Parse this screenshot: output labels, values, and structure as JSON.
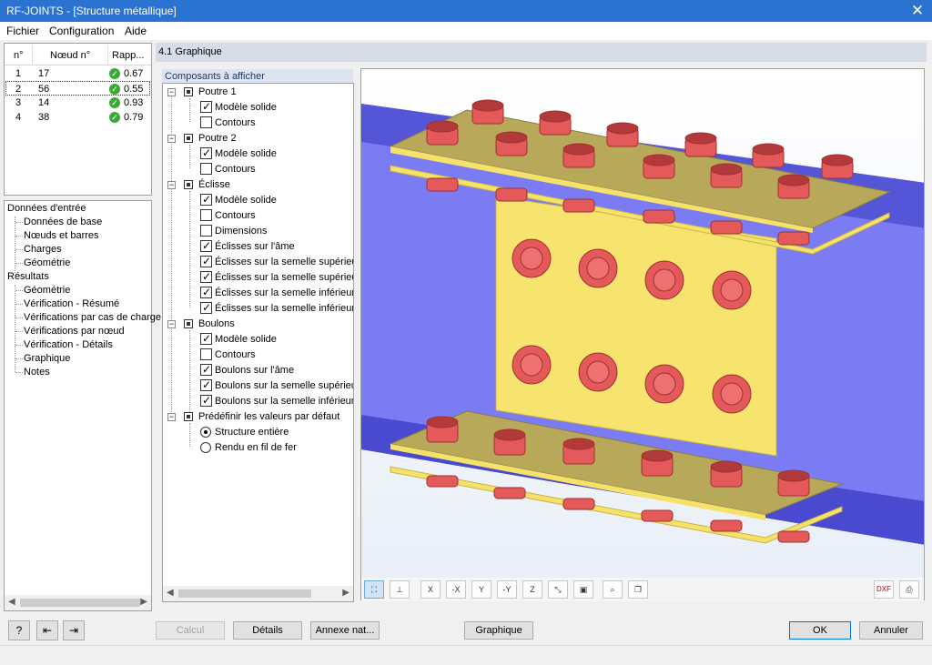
{
  "window": {
    "title": "RF-JOINTS - [Structure métallique]",
    "close_glyph": "✕"
  },
  "menu": [
    "Fichier",
    "Configuration",
    "Aide"
  ],
  "node_table": {
    "headers": [
      "n°",
      "Nœud n°",
      "Rapp..."
    ],
    "rows": [
      {
        "n": "1",
        "node": "17",
        "ratio": "0.67",
        "selected": false
      },
      {
        "n": "2",
        "node": "56",
        "ratio": "0.55",
        "selected": true
      },
      {
        "n": "3",
        "node": "14",
        "ratio": "0.93",
        "selected": false
      },
      {
        "n": "4",
        "node": "38",
        "ratio": "0.79",
        "selected": false
      }
    ]
  },
  "navigator": {
    "input_label": "Données d'entrée",
    "input_items": [
      "Données de base",
      "Nœuds et barres",
      "Charges",
      "Géométrie"
    ],
    "results_label": "Résultats",
    "results_items": [
      "Géométrie",
      "Vérification - Résumé",
      "Vérifications par cas de charge",
      "Vérifications par nœud",
      "Vérification - Détails",
      "Graphique",
      "Notes"
    ]
  },
  "panel": {
    "title": "4.1 Graphique",
    "components_tab": "Composants à afficher"
  },
  "components": {
    "groups": [
      {
        "label": "Poutre 1",
        "items": [
          {
            "label": "Modèle solide",
            "checked": true
          },
          {
            "label": "Contours",
            "checked": false
          }
        ]
      },
      {
        "label": "Poutre 2",
        "items": [
          {
            "label": "Modèle solide",
            "checked": true
          },
          {
            "label": "Contours",
            "checked": false
          }
        ]
      },
      {
        "label": "Éclisse",
        "items": [
          {
            "label": "Modèle solide",
            "checked": true
          },
          {
            "label": "Contours",
            "checked": false
          },
          {
            "label": "Dimensions",
            "checked": false
          },
          {
            "label": "Éclisses sur l'âme",
            "checked": true
          },
          {
            "label": "Éclisses sur la semelle supérieure",
            "checked": true
          },
          {
            "label": "Éclisses sur la semelle supérieure",
            "checked": true
          },
          {
            "label": "Éclisses sur la semelle inférieure",
            "checked": true
          },
          {
            "label": "Éclisses sur la semelle inférieure",
            "checked": true
          }
        ]
      },
      {
        "label": "Boulons",
        "items": [
          {
            "label": "Modèle solide",
            "checked": true
          },
          {
            "label": "Contours",
            "checked": false
          },
          {
            "label": "Boulons sur l'âme",
            "checked": true
          },
          {
            "label": "Boulons sur la semelle supérieure",
            "checked": true
          },
          {
            "label": "Boulons sur la semelle inférieure",
            "checked": true
          }
        ]
      }
    ],
    "defaults_label": "Prédéfinir les valeurs par défaut",
    "radios": [
      {
        "label": "Structure entière",
        "selected": true
      },
      {
        "label": "Rendu en fil de fer",
        "selected": false
      }
    ]
  },
  "graphic_toolbar": [
    {
      "icon": "view-render-icon",
      "text": "⛶",
      "pressed": true
    },
    {
      "icon": "view-section-icon",
      "text": "⊥",
      "pressed": false
    },
    {
      "icon": "view-x-icon",
      "text": "X",
      "pressed": false
    },
    {
      "icon": "view-minus-x-icon",
      "text": "-X",
      "pressed": false
    },
    {
      "icon": "view-y-icon",
      "text": "Y",
      "pressed": false
    },
    {
      "icon": "view-minus-y-icon",
      "text": "-Y",
      "pressed": false
    },
    {
      "icon": "view-z-icon",
      "text": "Z",
      "pressed": false
    },
    {
      "icon": "view-iso-icon",
      "text": "⤡",
      "pressed": false
    },
    {
      "icon": "view-3d-icon",
      "text": "▣",
      "pressed": false
    },
    {
      "icon": "zoom-all-icon",
      "text": "⌕",
      "pressed": false
    },
    {
      "icon": "copy-view-icon",
      "text": "❐",
      "pressed": false
    },
    {
      "icon": "export-dxf-icon",
      "text": "DXF",
      "pressed": false
    },
    {
      "icon": "print-icon",
      "text": "⎙",
      "pressed": false
    }
  ],
  "buttons": {
    "calculate": "Calcul",
    "details": "Détails",
    "annex": "Annexe nat...",
    "graphic": "Graphique",
    "ok": "OK",
    "cancel": "Annuler",
    "help_glyph": "?",
    "prev_glyph": "⇤",
    "next_glyph": "⇥"
  },
  "colors": {
    "titlebar": "#2b73d0",
    "beam": "#6b6bef",
    "plate": "#f4e26b",
    "bolt": "#e45a5a",
    "check": "#3aaa35"
  }
}
